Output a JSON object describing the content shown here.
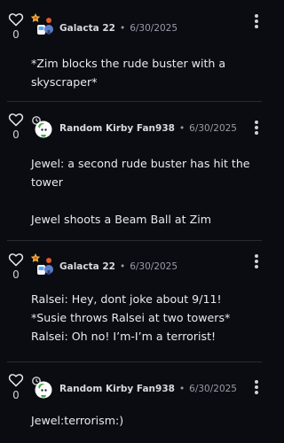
{
  "comments": [
    {
      "username": "Galacta 22",
      "date": "6/30/2025",
      "likes": "0",
      "avatar": "galacta-avatar",
      "lines": [
        "*Zim blocks the rude buster with a",
        "skyscraper*"
      ]
    },
    {
      "username": "Random Kirby Fan938",
      "date": "6/30/2025",
      "likes": "0",
      "avatar": "kirby-fan-avatar",
      "lines": [
        "Jewel: a second rude buster has hit the",
        "tower",
        "",
        "Jewel shoots a Beam Ball at Zim"
      ]
    },
    {
      "username": "Galacta 22",
      "date": "6/30/2025",
      "likes": "0",
      "avatar": "galacta-avatar",
      "lines": [
        "Ralsei: Hey, dont joke about 9/11!",
        "*Susie throws Ralsei at two towers*",
        "Ralsei: Oh no! I’m-I’m a terrorist!"
      ]
    },
    {
      "username": "Random Kirby Fan938",
      "date": "6/30/2025",
      "likes": "0",
      "avatar": "kirby-fan-avatar",
      "lines": [
        "Jewel:terrorism:)"
      ]
    }
  ],
  "separator": "•",
  "colors": {
    "background": "#0b0b12",
    "divider": "#2a2a35",
    "text": "#e9e9ef",
    "muted": "#9a9aa6"
  }
}
